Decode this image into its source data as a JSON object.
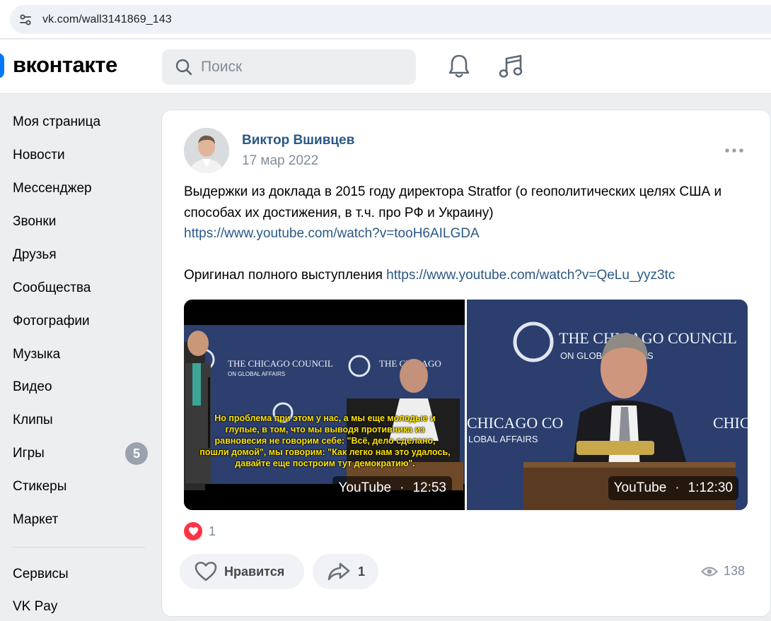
{
  "browser": {
    "url": "vk.com/wall3141869_143"
  },
  "header": {
    "logo": "вконтакте",
    "search_placeholder": "Поиск"
  },
  "sidebar": {
    "items": [
      {
        "label": "Моя страница"
      },
      {
        "label": "Новости"
      },
      {
        "label": "Мессенджер"
      },
      {
        "label": "Звонки"
      },
      {
        "label": "Друзья"
      },
      {
        "label": "Сообщества"
      },
      {
        "label": "Фотографии"
      },
      {
        "label": "Музыка"
      },
      {
        "label": "Видео"
      },
      {
        "label": "Клипы"
      },
      {
        "label": "Игры",
        "badge": "5"
      },
      {
        "label": "Стикеры"
      },
      {
        "label": "Маркет"
      }
    ],
    "secondary": [
      {
        "label": "Сервисы"
      },
      {
        "label": "VK Pay"
      }
    ]
  },
  "post": {
    "author": "Виктор Вшивцев",
    "date": "17 мар 2022",
    "text_line1": "Выдержки из доклада в 2015 году директора Stratfor (о геополитических целях США и способах их достижения, в т.ч. про РФ и Украину)",
    "link1": "https://www.youtube.com/watch?v=tooH6AILGDA",
    "text_line2": "Оригинал полного выступления",
    "link2": "https://www.youtube.com/watch?v=QeLu_yyz3tc",
    "videos": [
      {
        "source": "YouTube",
        "separator": "·",
        "duration": "12:53",
        "subtitle": "Но проблема при этом у нас, а мы еще молодые и глупые, в том, что мы выводя противника из равновесия не говорим себе: \"Всё, дело сделано, пошли домой\", мы говорим: \"Как легко нам это удалось, давайте еще построим тут демократию\".",
        "banner_top": "THE CHICAGO COUNCIL",
        "banner_bottom": "ON GLOBAL AFFAIRS"
      },
      {
        "source": "YouTube",
        "separator": "·",
        "duration": "1:12:30",
        "banner_top": "THE CHICAGO COUNCIL",
        "banner_bottom": "ON GLOBAL AFFAIRS"
      }
    ],
    "reactions_count": "1",
    "like_label": "Нравится",
    "share_count": "1",
    "views": "138"
  },
  "colors": {
    "accent": "#0077ff",
    "link": "#2a5885",
    "heart": "#ff3347"
  }
}
